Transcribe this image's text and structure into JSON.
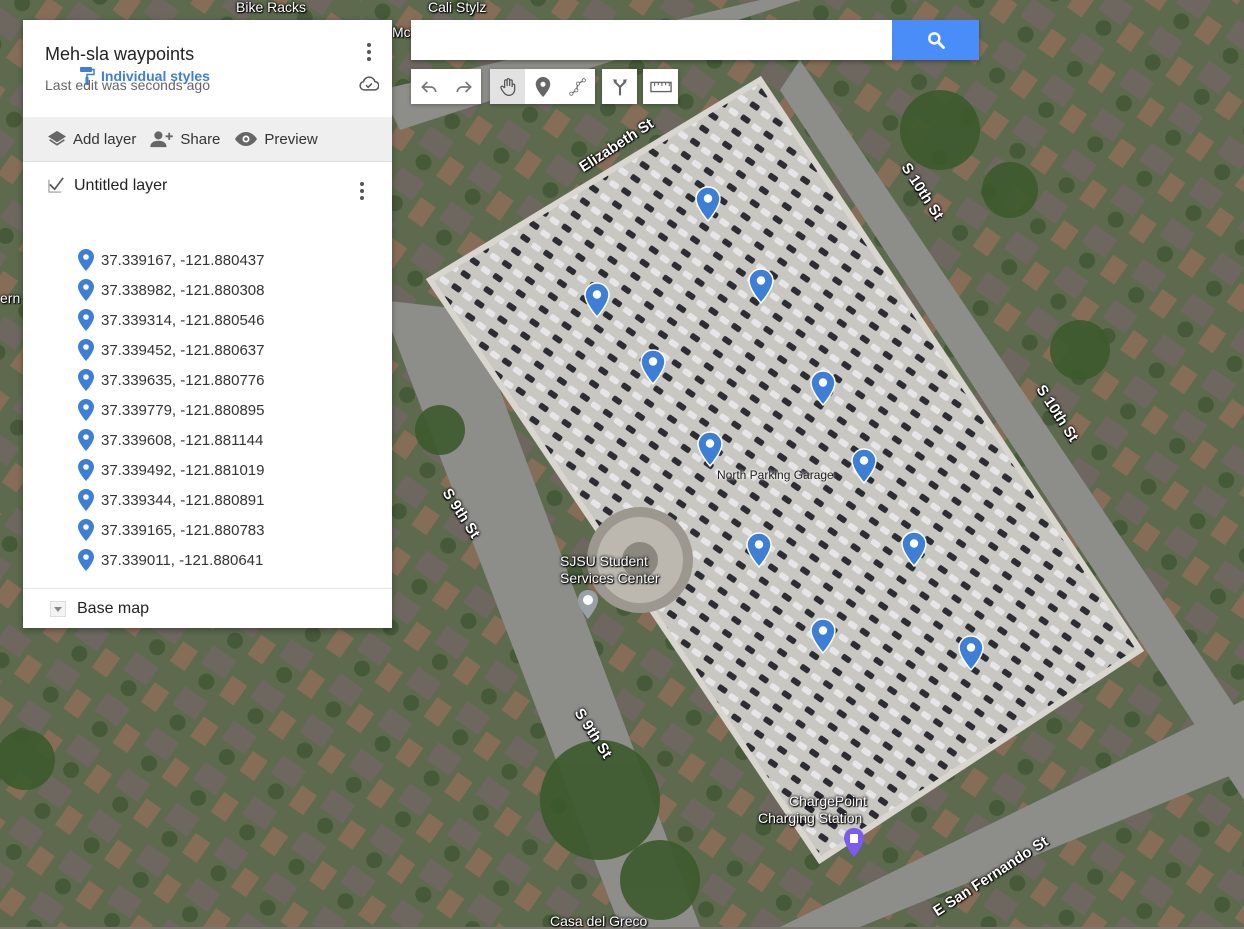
{
  "panel": {
    "title": "Meh-sla waypoints",
    "last_edit": "Last edit was seconds ago",
    "actions": {
      "add_layer": "Add layer",
      "share": "Share",
      "preview": "Preview"
    },
    "layer": {
      "name": "Untitled layer",
      "styles_label": "Individual styles",
      "items": [
        {
          "label": "37.339167, -121.880437"
        },
        {
          "label": "37.338982, -121.880308"
        },
        {
          "label": "37.339314, -121.880546"
        },
        {
          "label": "37.339452, -121.880637"
        },
        {
          "label": "37.339635, -121.880776"
        },
        {
          "label": "37.339779, -121.880895"
        },
        {
          "label": "37.339608, -121.881144"
        },
        {
          "label": "37.339492, -121.881019"
        },
        {
          "label": "37.339344, -121.880891"
        },
        {
          "label": "37.339165, -121.880783"
        },
        {
          "label": "37.339011, -121.880641"
        }
      ]
    },
    "base_map_label": "Base map"
  },
  "search": {
    "value": "",
    "placeholder": ""
  },
  "map_labels": {
    "bike_racks": "Bike Racks",
    "cali_stylz": "Cali Stylz",
    "mc": "Mc",
    "ern": "ern",
    "elizabeth_st": "Elizabeth St",
    "s10th_a": "S 10th St",
    "s10th_b": "S 10th St",
    "s9th_a": "S 9th St",
    "s9th_b": "S 9th St",
    "north_garage": "North Parking Garage",
    "sjsu_line1": "SJSU Student",
    "sjsu_line2": "Services Center",
    "chargepoint_line1": "ChargePoint",
    "chargepoint_line2": "Charging Station",
    "san_fernando": "E San Fernando St",
    "casa": "Casa del Greco"
  },
  "colors": {
    "pin": "#3d7fd6",
    "search_button": "#4b8df8",
    "accent_link": "#3d7fd6"
  },
  "icons": {
    "toolbar": [
      "undo-icon",
      "redo-icon",
      "hand-icon",
      "marker-icon",
      "draw-line-icon",
      "directions-icon",
      "ruler-icon"
    ]
  }
}
